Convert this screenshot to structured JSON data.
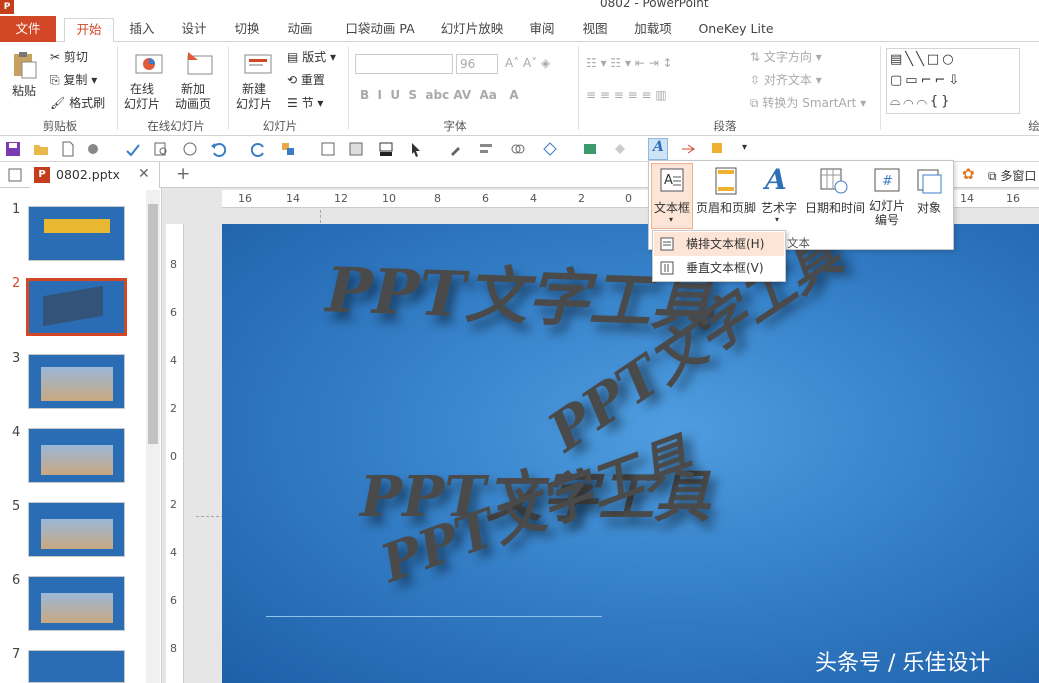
{
  "window": {
    "title": "0802 - PowerPoint",
    "app_icon": "P"
  },
  "tabs": [
    "文件",
    "开始",
    "插入",
    "设计",
    "切换",
    "动画",
    "口袋动画 PA",
    "幻灯片放映",
    "审阅",
    "视图",
    "加载项",
    "OneKey Lite"
  ],
  "ribbon": {
    "clipboard": {
      "paste": "粘贴",
      "cut": "剪切",
      "copy": "复制",
      "format_painter": "格式刷",
      "label": "剪贴板"
    },
    "online": {
      "online_slide": "在线\n幻灯片",
      "new_anim_page": "新加\n动画页",
      "label": "在线幻灯片"
    },
    "slides": {
      "new_slide": "新建\n幻灯片",
      "layout": "版式",
      "reset": "重置",
      "section": "节",
      "label": "幻灯片"
    },
    "font": {
      "size": "96",
      "label": "字体"
    },
    "paragraph": {
      "text_direction": "文字方向",
      "align_text": "对齐文本",
      "smartart": "转换为 SmartArt",
      "label": "段落"
    },
    "drawing_label": "绘"
  },
  "doc_tab": {
    "name": "0802.pptx",
    "right": "多窗口"
  },
  "thumbnails": [
    "1",
    "2",
    "3",
    "4",
    "5",
    "6",
    "7"
  ],
  "insert_dropdown": {
    "items": [
      "文本框",
      "页眉和页脚",
      "艺术字",
      "日期和时间",
      "幻灯片\n编号",
      "对象"
    ],
    "group_label": "文本"
  },
  "textbox_menu": [
    "横排文本框(H)",
    "垂直文本框(V)"
  ],
  "slide": {
    "text1": "PPT文字工具",
    "text2": "PPT文字工具",
    "text3": "PPT文字工具",
    "text4": "PPT文字工具"
  },
  "watermark": "头条号 / 乐佳设计",
  "ruler_h": [
    "16",
    "14",
    "12",
    "10",
    "8",
    "6",
    "4",
    "2",
    "0",
    "14",
    "16"
  ],
  "ruler_v": [
    "8",
    "6",
    "4",
    "2",
    "0",
    "2",
    "4",
    "6",
    "8"
  ]
}
